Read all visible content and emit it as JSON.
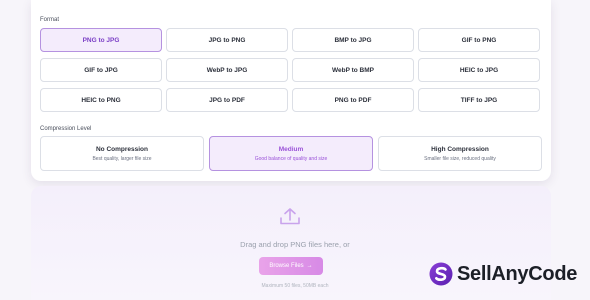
{
  "format": {
    "label": "Format",
    "options": [
      "PNG to JPG",
      "JPG to PNG",
      "BMP to JPG",
      "GIF to PNG",
      "GIF to JPG",
      "WebP to JPG",
      "WebP to BMP",
      "HEIC to JPG",
      "HEIC to PNG",
      "JPG to PDF",
      "PNG to PDF",
      "TIFF to JPG"
    ],
    "selected": "PNG to JPG"
  },
  "compression": {
    "label": "Compression Level",
    "options": [
      {
        "title": "No Compression",
        "subtitle": "Best quality, larger file size"
      },
      {
        "title": "Medium",
        "subtitle": "Good balance of quality and size"
      },
      {
        "title": "High Compression",
        "subtitle": "Smaller file size, reduced quality"
      }
    ],
    "selected": "Medium"
  },
  "upload": {
    "icon": "upload-icon",
    "prompt": "Drag and drop PNG files here, or",
    "browse_label": "Browse Files",
    "browse_arrow": "→",
    "limit": "Maximum 50 files, 50MB each"
  },
  "watermark": {
    "text": "SellAnyCode",
    "icon": "sellanycode-logo-icon"
  },
  "colors": {
    "accent": "#9a52d8",
    "active_bg": "#f4ecfc",
    "active_border": "#b592e0",
    "button_gradient_start": "#e9a3e9",
    "button_gradient_end": "#d78ae6"
  }
}
